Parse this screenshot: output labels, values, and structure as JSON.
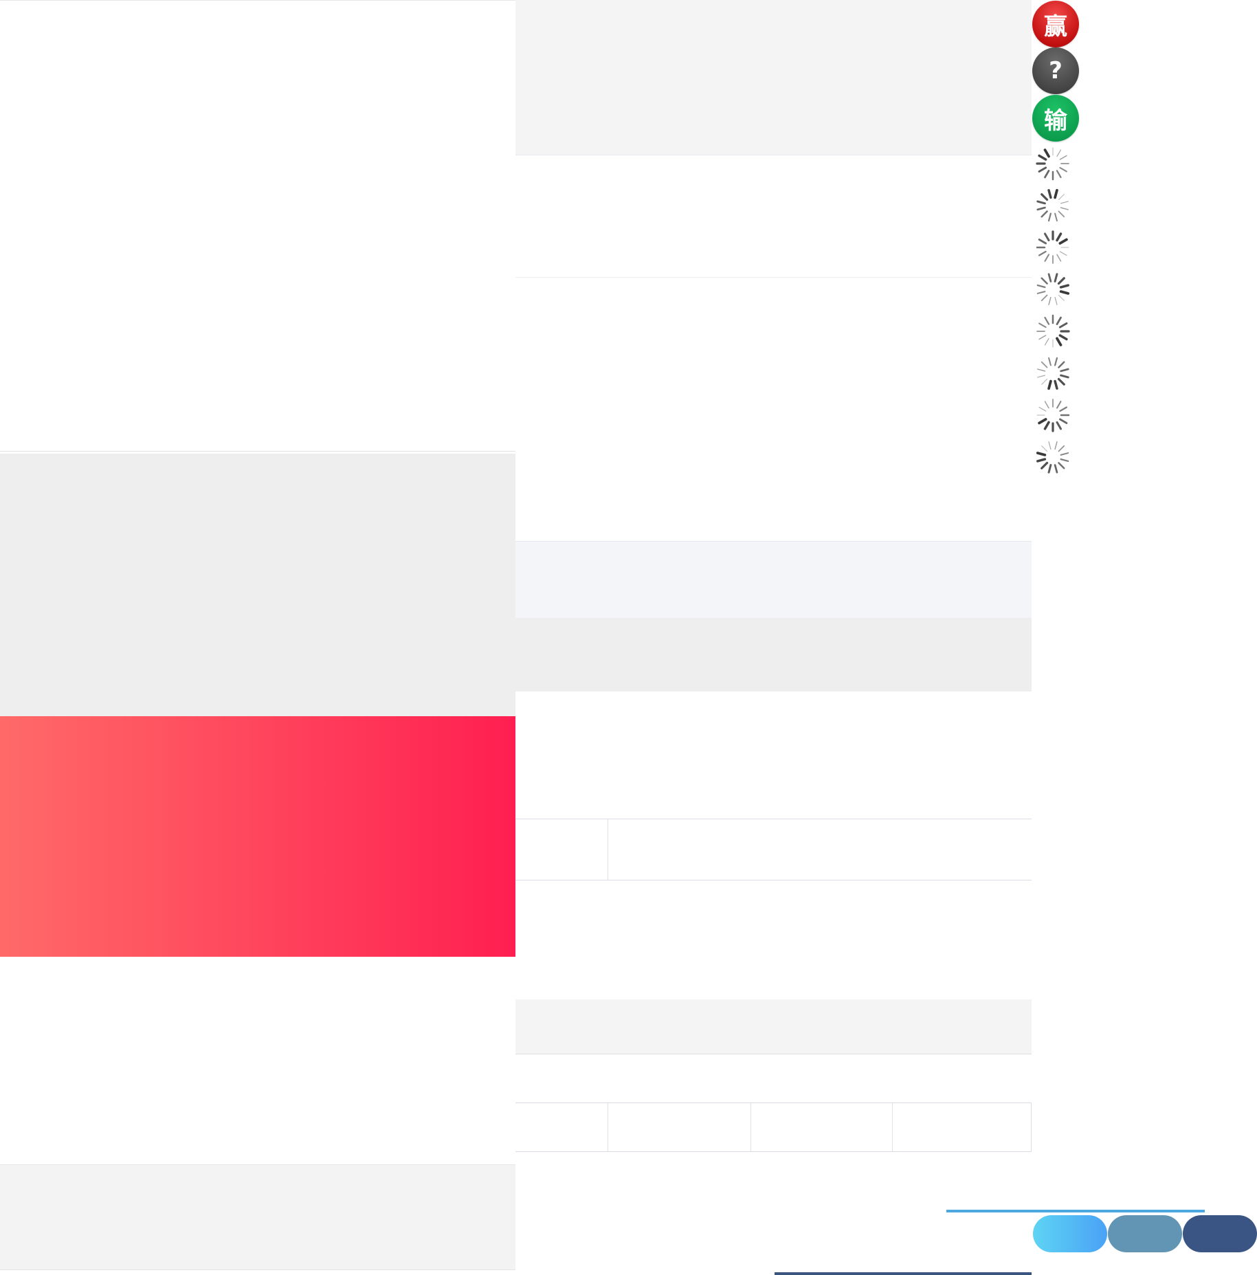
{
  "floating_buttons": {
    "win_label": "赢",
    "help_label": "?",
    "lose_label": "输"
  },
  "colors": {
    "banner_gradient_start": "#ff6a68",
    "banner_gradient_end": "#ff1f51",
    "win_red": "#c41010",
    "help_gray": "#3f3f3f",
    "lose_green": "#0a9a4b",
    "progress_blue": "#4ea8e0",
    "pill_1": "#4aa2f5",
    "pill_2": "#6295b4",
    "pill_3": "#3a5583"
  },
  "spinners": [
    "loading-spinner-icon",
    "loading-spinner-icon",
    "loading-spinner-icon",
    "loading-spinner-icon",
    "loading-spinner-icon",
    "loading-spinner-icon",
    "loading-spinner-icon",
    "loading-spinner-icon"
  ]
}
